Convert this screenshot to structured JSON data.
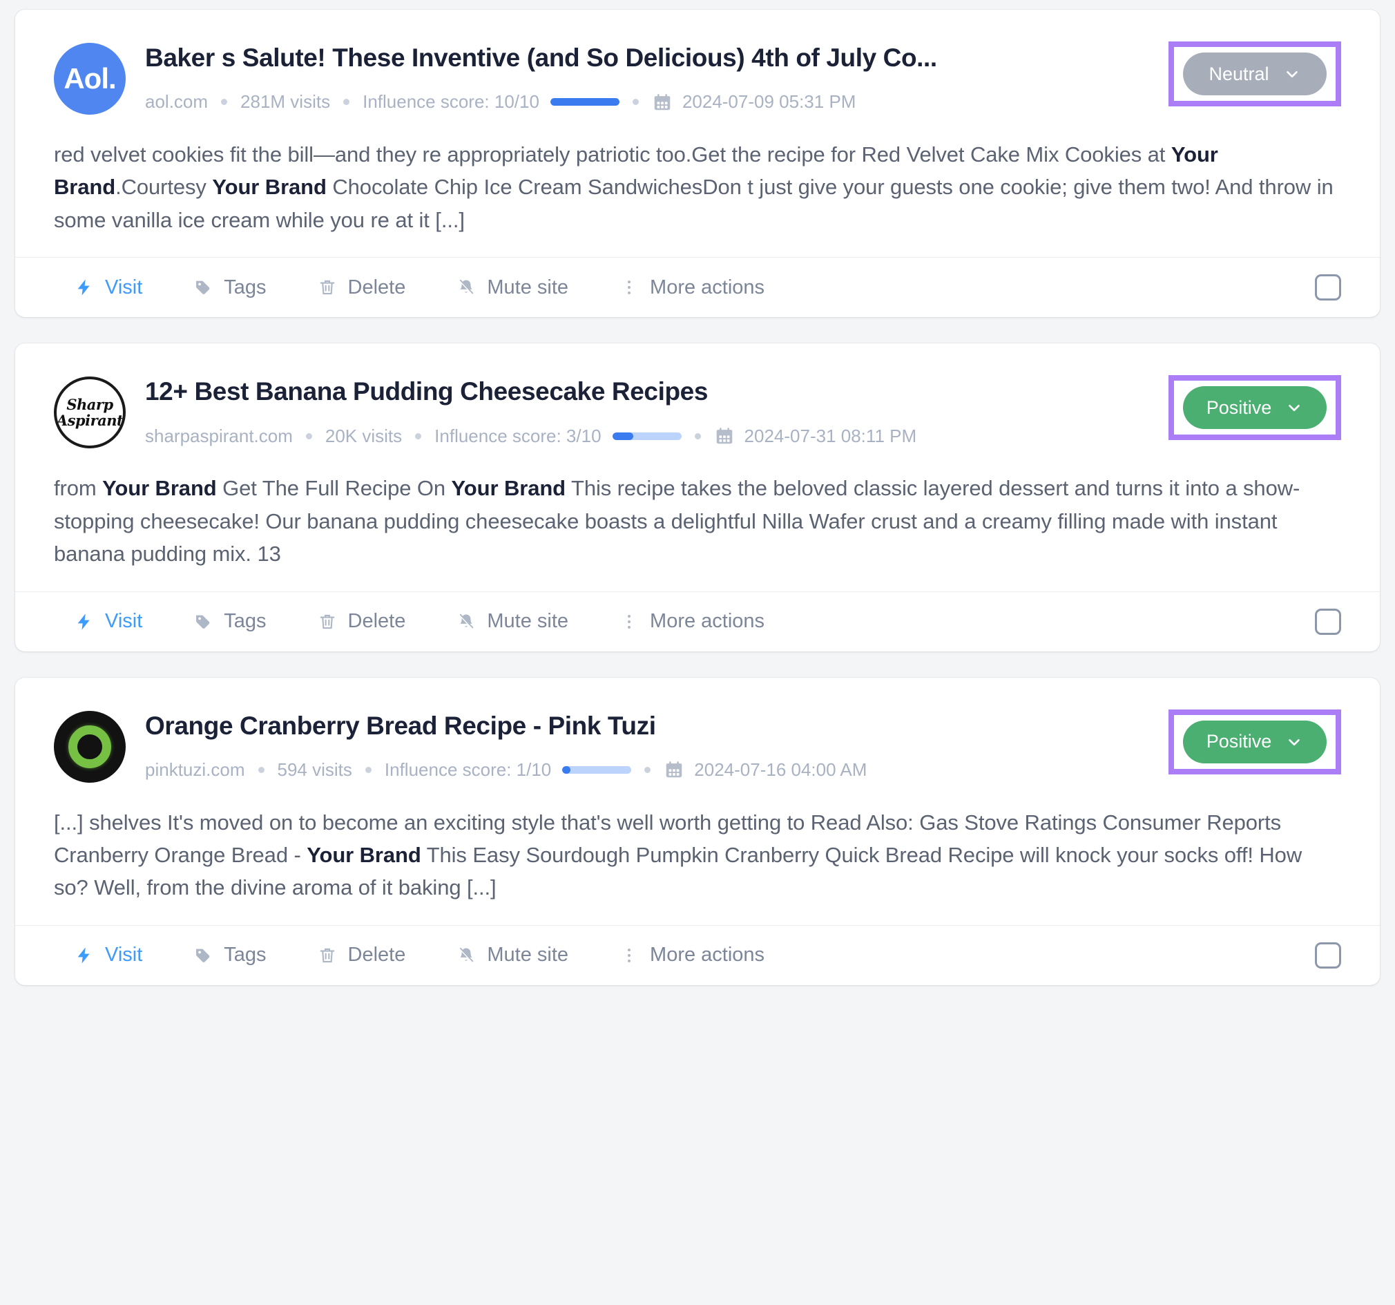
{
  "colors": {
    "positive": "#4caf72",
    "neutral": "#a7aeb9",
    "highlight": "#ab7df6",
    "visit_link": "#3d9bfb",
    "score_fill": "#3a7bef",
    "score_track": "#bcd4fb"
  },
  "actions": {
    "visit": "Visit",
    "tags": "Tags",
    "delete": "Delete",
    "mute": "Mute site",
    "more": "More actions"
  },
  "cards": [
    {
      "avatar_kind": "aol-logo",
      "avatar_text": "Aol.",
      "title": "Baker s Salute! These Inventive (and So Delicious) 4th of July Co...",
      "domain": "aol.com",
      "visits": "281M visits",
      "influence_label": "Influence score: 10/10",
      "influence_percent": 100,
      "date": "2024-07-09 05:31 PM",
      "sentiment": "Neutral",
      "sentiment_color": "#a7aeb9",
      "snippet_parts": [
        {
          "t": "red velvet cookies fit the bill—and they re appropriately patriotic too.Get the recipe for Red Velvet Cake Mix Cookies at ",
          "b": false
        },
        {
          "t": "Your Brand",
          "b": true
        },
        {
          "t": ".Courtesy ",
          "b": false
        },
        {
          "t": "Your Brand",
          "b": true
        },
        {
          "t": " Chocolate Chip Ice Cream SandwichesDon t just give your guests one cookie; give them two! And throw in some vanilla ice cream while you re at it [...]",
          "b": false
        }
      ]
    },
    {
      "avatar_kind": "sharp-aspirant-logo",
      "avatar_text": "Sharp Aspirant",
      "title": "12+ Best Banana Pudding Cheesecake Recipes",
      "domain": "sharpaspirant.com",
      "visits": "20K visits",
      "influence_label": "Influence score: 3/10",
      "influence_percent": 30,
      "date": "2024-07-31 08:11 PM",
      "sentiment": "Positive",
      "sentiment_color": "#4caf72",
      "snippet_parts": [
        {
          "t": "from ",
          "b": false
        },
        {
          "t": "Your Brand",
          "b": true
        },
        {
          "t": " Get The Full Recipe On ",
          "b": false
        },
        {
          "t": "Your Brand",
          "b": true
        },
        {
          "t": " This recipe takes the beloved classic layered dessert and turns it into a show-stopping cheesecake! Our banana pudding cheesecake boasts a delightful Nilla Wafer crust and a creamy filling made with instant banana pudding mix. 13",
          "b": false
        }
      ]
    },
    {
      "avatar_kind": "pink-tuzi-logo",
      "avatar_text": "",
      "title": "Orange Cranberry Bread Recipe - Pink Tuzi",
      "domain": "pinktuzi.com",
      "visits": "594 visits",
      "influence_label": "Influence score: 1/10",
      "influence_percent": 12,
      "date": "2024-07-16 04:00 AM",
      "sentiment": "Positive",
      "sentiment_color": "#4caf72",
      "snippet_parts": [
        {
          "t": "[...] shelves It's moved on to become an exciting style that's well worth getting to Read Also: Gas Stove Ratings Consumer Reports Cranberry Orange Bread - ",
          "b": false
        },
        {
          "t": "Your Brand",
          "b": true
        },
        {
          "t": " This Easy Sourdough Pumpkin Cranberry Quick Bread Recipe will knock your socks off! How so? Well, from the divine aroma of it baking [...]",
          "b": false
        }
      ]
    }
  ]
}
